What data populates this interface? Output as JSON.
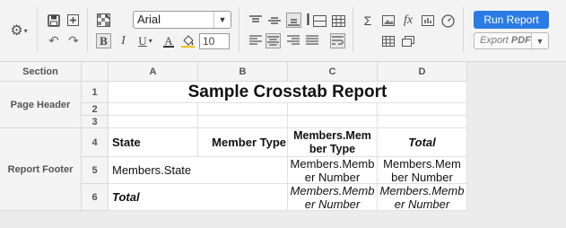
{
  "toolbar": {
    "font_name": "Arial",
    "font_size": "10",
    "bold_label": "B",
    "italic_label": "I",
    "underline_label": "U",
    "formula_label": "fx",
    "sum_label": "Σ",
    "run_report_label": "Run Report",
    "export_label": "Export",
    "export_format": "PDF"
  },
  "grid": {
    "section_header": "Section",
    "columns": [
      "A",
      "B",
      "C",
      "D"
    ],
    "rows": [
      "1",
      "2",
      "3",
      "4",
      "5",
      "6"
    ],
    "sections": {
      "page_header": "Page Header",
      "report_footer": "Report Footer"
    },
    "title": "Sample Crosstab Report",
    "row4": {
      "a": "State",
      "b": "Member Type",
      "c_line1": "Members.Mem",
      "c_line2": "ber Type",
      "d": "Total"
    },
    "row5": {
      "a": "Members.State",
      "c_line1": "Members.Memb",
      "c_line2": "er Number",
      "d_line1": "Members.Mem",
      "d_line2": "ber Number"
    },
    "row6": {
      "a": "Total",
      "c_line1": "Members.Memb",
      "c_line2": "er Number",
      "d_line1": "Members.Memb",
      "d_line2": "er Number"
    }
  }
}
